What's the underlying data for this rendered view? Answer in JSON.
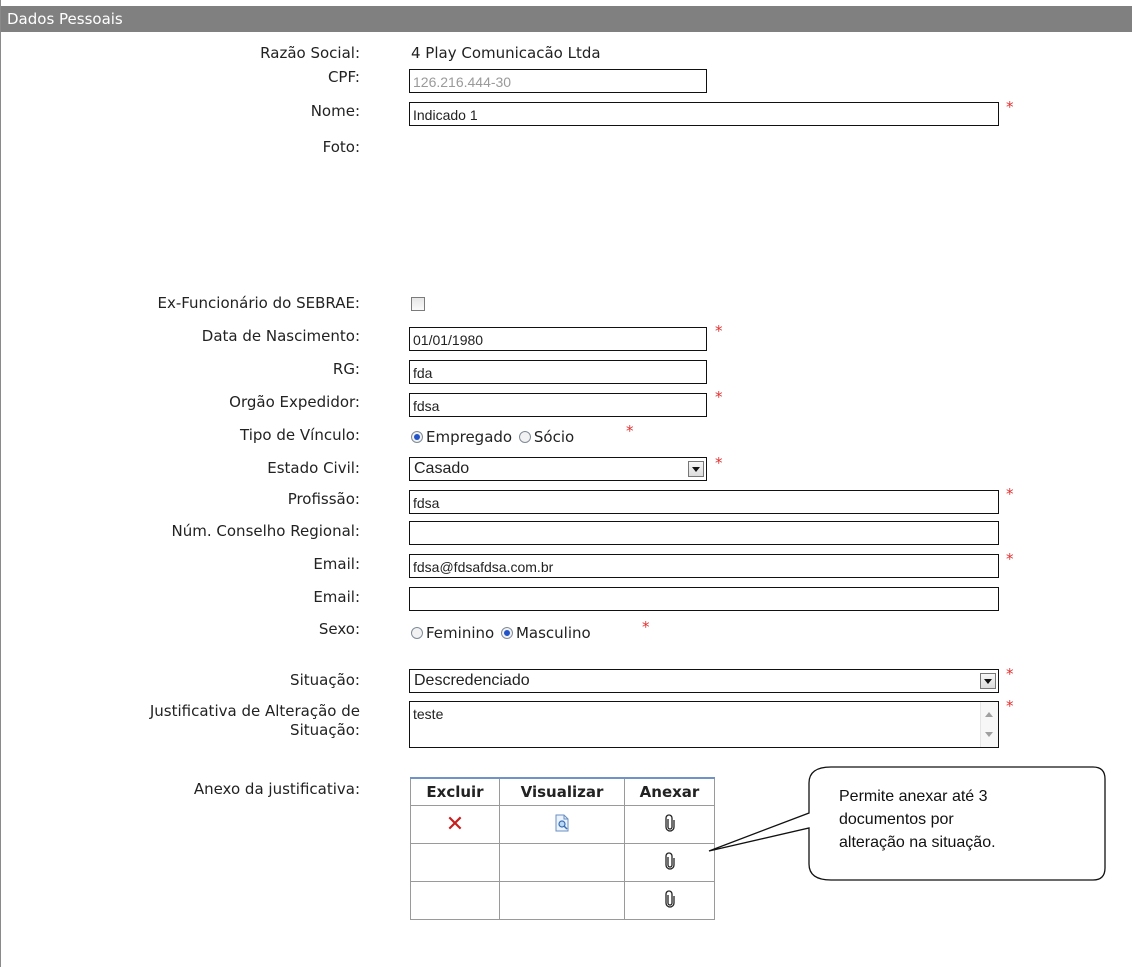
{
  "section": {
    "title": "Dados Pessoais"
  },
  "form": {
    "razao_social": {
      "label": "Razão Social:",
      "value": "4 Play Comunicacão Ltda"
    },
    "cpf": {
      "label": "CPF:",
      "value": "126.216.444-30"
    },
    "nome": {
      "label": "Nome:",
      "value": "Indicado 1"
    },
    "foto": {
      "label": "Foto:"
    },
    "ex_funcionario": {
      "label": "Ex-Funcionário do SEBRAE:",
      "checked": false
    },
    "data_nascimento": {
      "label": "Data de Nascimento:",
      "value": "01/01/1980"
    },
    "rg": {
      "label": "RG:",
      "value": "fda"
    },
    "orgao_expedidor": {
      "label": "Orgão Expedidor:",
      "value": "fdsa"
    },
    "tipo_vinculo": {
      "label": "Tipo de Vínculo:",
      "options": [
        "Empregado",
        "Sócio"
      ],
      "selected": "Empregado"
    },
    "estado_civil": {
      "label": "Estado Civil:",
      "value": "Casado"
    },
    "profissao": {
      "label": "Profissão:",
      "value": "fdsa"
    },
    "num_conselho": {
      "label": "Núm. Conselho Regional:",
      "value": ""
    },
    "email1": {
      "label": "Email:",
      "value": "fdsa@fdsafdsa.com.br"
    },
    "email2": {
      "label": "Email:",
      "value": ""
    },
    "sexo": {
      "label": "Sexo:",
      "options": [
        "Feminino",
        "Masculino"
      ],
      "selected": "Masculino"
    },
    "situacao": {
      "label": "Situação:",
      "value": "Descredenciado"
    },
    "justificativa": {
      "label_line1": "Justificativa de Alteração de",
      "label_line2": "Situação:",
      "value": "teste"
    },
    "anexo": {
      "label": "Anexo da justificativa:",
      "columns": [
        "Excluir",
        "Visualizar",
        "Anexar"
      ],
      "rows": [
        {
          "excluir": "x-icon",
          "visualizar": "document-view-icon",
          "anexar": "paperclip-icon"
        },
        {
          "excluir": "",
          "visualizar": "",
          "anexar": "paperclip-icon"
        },
        {
          "excluir": "",
          "visualizar": "",
          "anexar": "paperclip-icon"
        }
      ]
    }
  },
  "required_marker": "*",
  "callout": {
    "line1": "Permite anexar até 3",
    "line2": "documentos por",
    "line3": "alteração na situação."
  },
  "colors": {
    "header_bg": "#808080",
    "required": "#e23131",
    "delete": "#c81e1e",
    "table_top_border": "#6f93c8"
  }
}
